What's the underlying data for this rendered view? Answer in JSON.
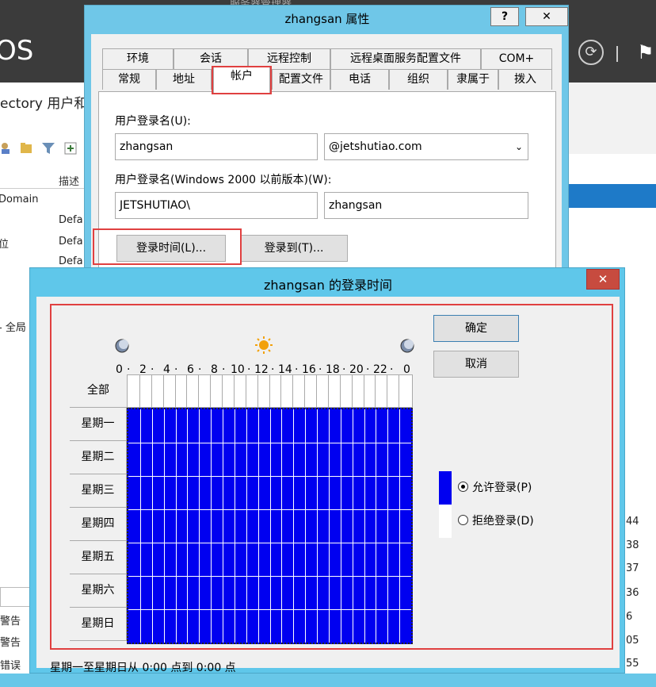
{
  "background": {
    "window_title": "服务器管理器",
    "logo_text": "OS",
    "ad_title": "ectory 用户和",
    "list_header_desc": "描述",
    "list_items": [
      "Domain",
      "Defa",
      "位",
      "Defa",
      "Defa",
      "- 全局"
    ],
    "bottom_items": [
      "警告",
      "警告",
      "错误"
    ],
    "right_numbers": [
      "44",
      "38",
      "37",
      "36",
      "6",
      "05",
      "55"
    ]
  },
  "props_dialog": {
    "title": "zhangsan 属性",
    "help_label": "?",
    "close_label": "✕",
    "tabs_row1": [
      "环境",
      "会话",
      "远程控制",
      "远程桌面服务配置文件",
      "COM+"
    ],
    "tabs_row2": [
      "常规",
      "地址",
      "帐户",
      "配置文件",
      "电话",
      "组织",
      "隶属于",
      "拨入"
    ],
    "active_tab": "帐户",
    "logon_name_label": "用户登录名(U):",
    "logon_name_value": "zhangsan",
    "upn_suffix_value": "@jetshutiao.com",
    "pre2000_label": "用户登录名(Windows 2000 以前版本)(W):",
    "pre2000_domain_value": "JETSHUTIAO\\",
    "pre2000_name_value": "zhangsan",
    "logon_hours_button": "登录时间(L)...",
    "logon_to_button": "登录到(T)..."
  },
  "hours_dialog": {
    "title": "zhangsan 的登录时间",
    "close_label": "✕",
    "hour_labels": [
      "0",
      "2",
      "4",
      "6",
      "8",
      "10",
      "12",
      "14",
      "16",
      "18",
      "20",
      "22",
      "0"
    ],
    "all_button": "全部",
    "days": [
      "星期一",
      "星期二",
      "星期三",
      "星期四",
      "星期五",
      "星期六",
      "星期日"
    ],
    "ok_button": "确定",
    "cancel_button": "取消",
    "permit_label": "允许登录(P)",
    "deny_label": "拒绝登录(D)",
    "permit_selected": true,
    "status_text": "星期一至星期日从 0:00 点到 0:00 点",
    "grid_fill_color": "#0000f0",
    "permitted_fraction": 1.0
  }
}
